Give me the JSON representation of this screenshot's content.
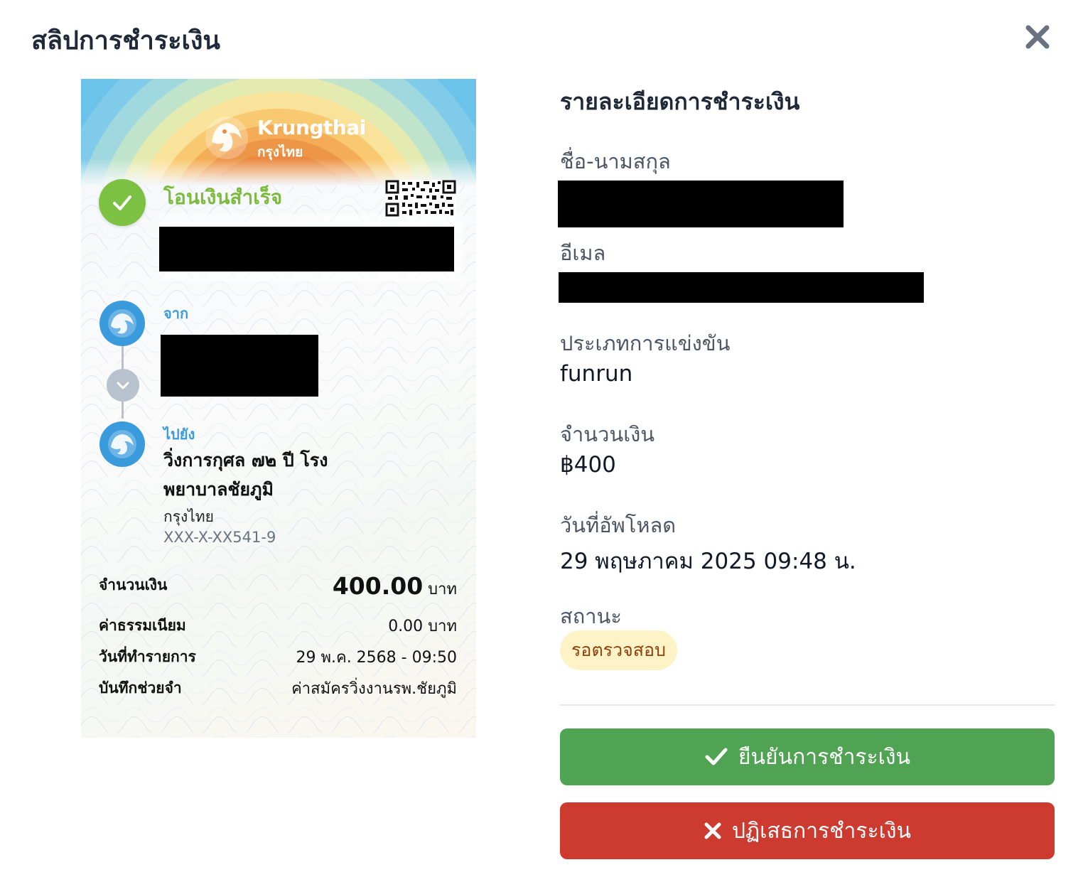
{
  "modal": {
    "title": "สลิปการชำระเงิน"
  },
  "slip": {
    "bank_name_en": "Krungthai",
    "bank_name_th": "กรุงไทย",
    "status_text": "โอนเงินสำเร็จ",
    "from_label": "จาก",
    "to_label": "ไปยัง",
    "to_name": "วิ่งการกุศล ๗๒ ปี โรงพยาบาลชัยภูมิ",
    "to_bank": "กรุงไทย",
    "to_account": "XXX-X-XX541-9",
    "rows": {
      "amount_label": "จำนวนเงิน",
      "amount_value": "400.00",
      "amount_unit": "บาท",
      "fee_label": "ค่าธรรมเนียม",
      "fee_value": "0.00 บาท",
      "date_label": "วันที่ทำรายการ",
      "date_value": "29 พ.ค. 2568 - 09:50",
      "memo_label": "บันทึกช่วยจำ",
      "memo_value": "ค่าสมัครวิ่งงานรพ.ชัยภูมิ"
    }
  },
  "details": {
    "title": "รายละเอียดการชำระเงิน",
    "name_label": "ชื่อ-นามสกุล",
    "email_label": "อีเมล",
    "race_type_label": "ประเภทการแข่งขัน",
    "race_type_value": "funrun",
    "amount_label": "จำนวนเงิน",
    "amount_value": "฿400",
    "upload_date_label": "วันที่อัพโหลด",
    "upload_date_value": "29 พฤษภาคม 2025 09:48 น.",
    "status_label": "สถานะ",
    "status_value": "รอตรวจสอบ"
  },
  "actions": {
    "confirm_label": "ยืนยันการชำระเงิน",
    "reject_label": "ปฏิเสธการชำระเงิน"
  },
  "colors": {
    "confirm": "#4fa352",
    "reject": "#cc3a30",
    "badge_bg": "#fef3c7",
    "badge_text": "#92400e",
    "success_green": "#7cc142",
    "krungthai_blue": "#3a9bdc"
  },
  "icons": {
    "close": "close-icon",
    "check": "check-icon",
    "x": "x-icon"
  }
}
